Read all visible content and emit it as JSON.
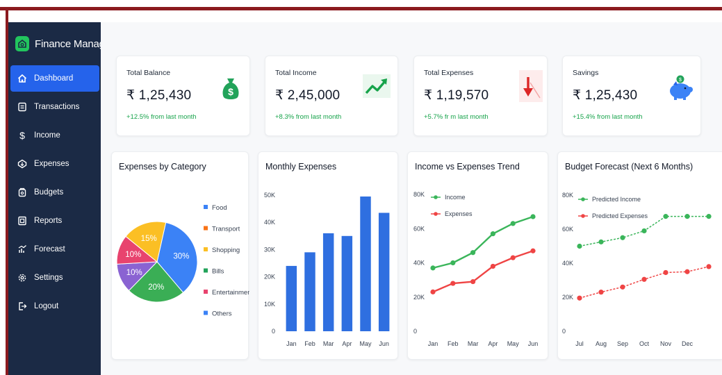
{
  "app": {
    "name": "Finance Manager"
  },
  "sidebar": {
    "items": [
      {
        "label": "Dashboard",
        "icon": "home-icon",
        "active": true
      },
      {
        "label": "Transactions",
        "icon": "list-icon",
        "active": false
      },
      {
        "label": "Income",
        "icon": "dollar-icon",
        "active": false
      },
      {
        "label": "Expenses",
        "icon": "expenses-icon",
        "active": false
      },
      {
        "label": "Budgets",
        "icon": "wallet-icon",
        "active": false
      },
      {
        "label": "Reports",
        "icon": "report-icon",
        "active": false
      },
      {
        "label": "Forecast",
        "icon": "forecast-icon",
        "active": false
      },
      {
        "label": "Settings",
        "icon": "gear-icon",
        "active": false
      },
      {
        "label": "Logout",
        "icon": "logout-icon",
        "active": false
      }
    ]
  },
  "stats": [
    {
      "title": "Total Balance",
      "value": "₹ 1,25,430",
      "change": "+12.5% from last month",
      "icon": "money-bag-icon"
    },
    {
      "title": "Total Income",
      "value": "₹ 2,45,000",
      "change": "+8.3% from last month",
      "icon": "trend-up-icon"
    },
    {
      "title": "Total Expenses",
      "value": "₹ 1,19,570",
      "change": "+5.7% fr m last month",
      "icon": "trend-down-icon"
    },
    {
      "title": "Savings",
      "value": "₹ 1,25,430",
      "change": "+15.4% from last month",
      "icon": "piggy-bank-icon"
    }
  ],
  "colors": {
    "sidebar": "#1b2a45",
    "active": "#2563eb",
    "green": "#22c55e",
    "red": "#ef4444",
    "bar": "#2f6fe0"
  },
  "chart_data": [
    {
      "type": "pie",
      "title": "Expenses by Category",
      "categories": [
        "Food",
        "Transport",
        "Shopping",
        "Bills",
        "Entertainment",
        "Others"
      ],
      "legend_colors": [
        "#3b82f6",
        "#f97316",
        "#fbbf24",
        "#22a35a",
        "#e8436e",
        "#3b82f6"
      ],
      "slices": [
        {
          "label": "30%",
          "value": 30,
          "color": "#3b82f6"
        },
        {
          "label": "20%",
          "value": 20,
          "color": "#3aae55"
        },
        {
          "label": "10%",
          "value": 10,
          "color": "#8a63d2"
        },
        {
          "label": "10%",
          "value": 10,
          "color": "#e8436e"
        },
        {
          "label": "15%",
          "value": 15,
          "color": "#fbbf24"
        }
      ],
      "legend_position": "right"
    },
    {
      "type": "bar",
      "title": "Monthly Expenses",
      "categories": [
        "Jan",
        "Feb",
        "Mar",
        "Apr",
        "May",
        "Jun"
      ],
      "values": [
        24000,
        29000,
        36000,
        35000,
        49500,
        43500
      ],
      "ylim": [
        0,
        50000
      ],
      "yticks": [
        0,
        10000,
        20000,
        30000,
        40000,
        50000
      ],
      "ytick_labels": [
        "0",
        "10K",
        "20K",
        "30K",
        "40K",
        "50K"
      ],
      "grid": false
    },
    {
      "type": "line",
      "title": "Income vs Expenses Trend",
      "categories": [
        "Jan",
        "Feb",
        "Mar",
        "Apr",
        "May",
        "Jun"
      ],
      "series": [
        {
          "name": "Income",
          "values": [
            37000,
            40000,
            46000,
            57000,
            63000,
            67000
          ],
          "color": "#3ab55a"
        },
        {
          "name": "Expenses",
          "values": [
            23000,
            28000,
            29000,
            38000,
            43000,
            47000
          ],
          "color": "#ef4444"
        }
      ],
      "ylim": [
        0,
        80000
      ],
      "yticks": [
        0,
        20000,
        40000,
        60000,
        80000
      ],
      "ytick_labels": [
        "0",
        "20K",
        "40K",
        "60K",
        "80K"
      ],
      "legend_position": "top-left"
    },
    {
      "type": "line",
      "title": "Budget Forecast (Next 6 Months)",
      "categories": [
        "Jul",
        "Aug",
        "Sep",
        "Oct",
        "Nov",
        "Dec",
        ""
      ],
      "series": [
        {
          "name": "Predicted Income",
          "values": [
            50000,
            52500,
            55000,
            59000,
            67500,
            67500,
            67500
          ],
          "color": "#3ab55a",
          "dashed": true
        },
        {
          "name": "Predicted Expenses",
          "values": [
            19500,
            23000,
            26000,
            30500,
            34500,
            35000,
            38000
          ],
          "color": "#ef4444",
          "dashed": true
        }
      ],
      "ylim": [
        0,
        80000
      ],
      "yticks": [
        0,
        20000,
        40000,
        60000,
        80000
      ],
      "ytick_labels": [
        "0",
        "20K",
        "40K",
        "60K",
        "80K"
      ],
      "legend_position": "top-left"
    }
  ]
}
